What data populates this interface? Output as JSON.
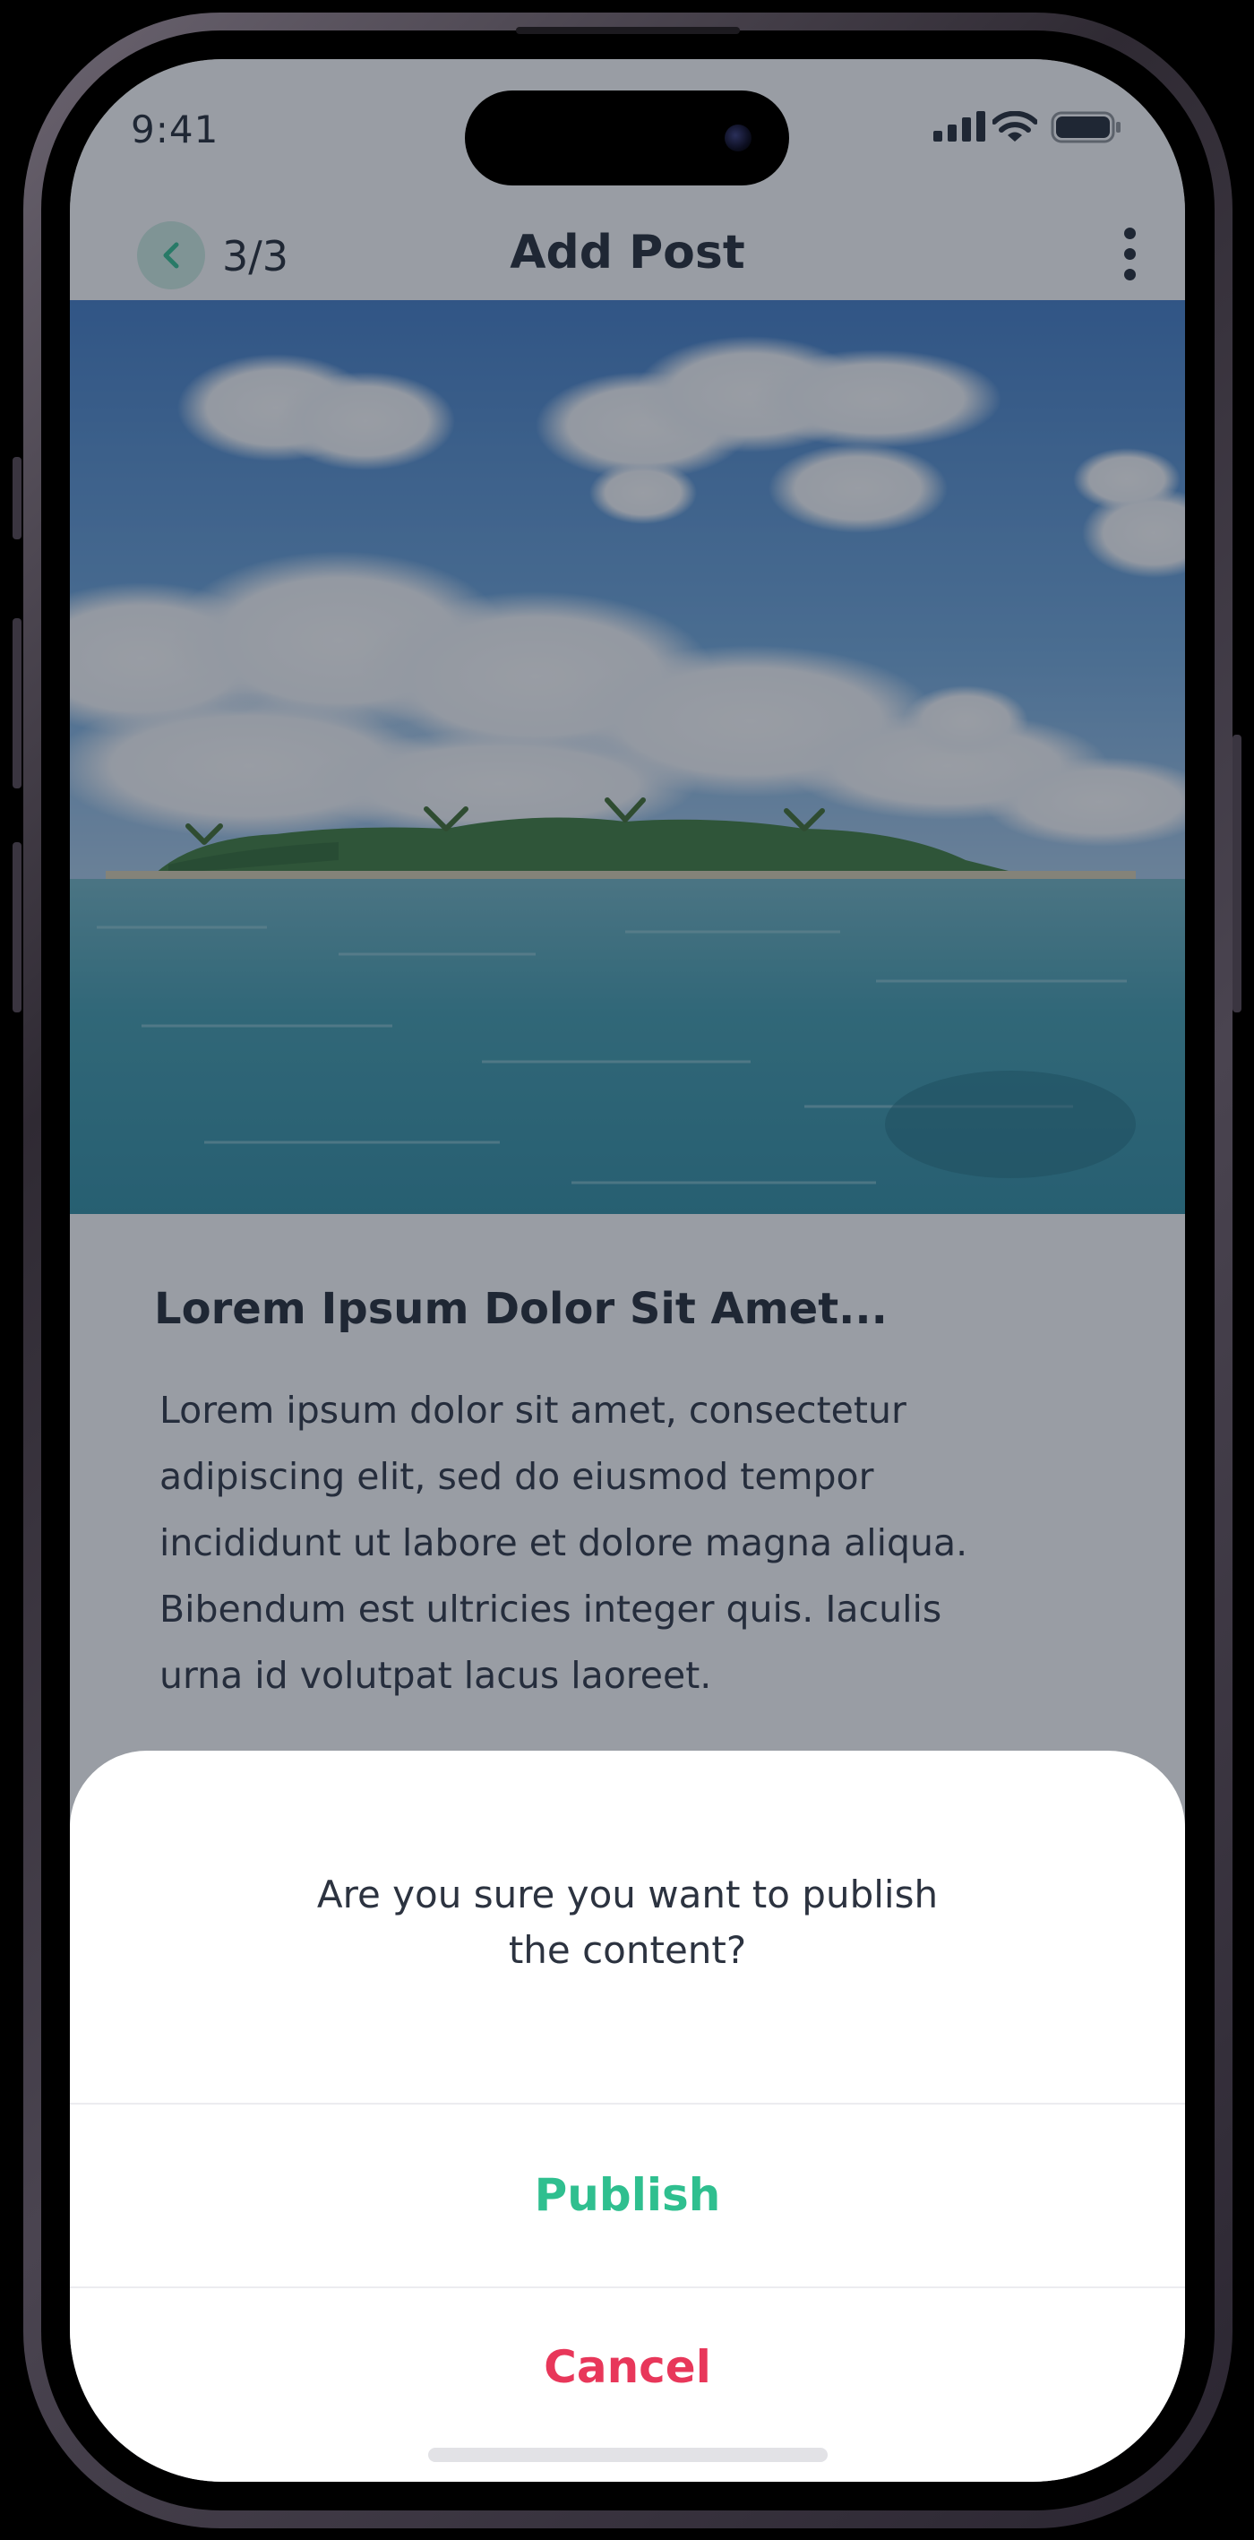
{
  "status_bar": {
    "time": "9:41",
    "icons": [
      "cellular-signal-icon",
      "wifi-icon",
      "battery-icon"
    ]
  },
  "header": {
    "back_icon": "chevron-left-icon",
    "step": "3/3",
    "title": "Add Post",
    "menu_icon": "more-vertical-icon"
  },
  "post": {
    "image_description": "tropical island photo",
    "title": "Lorem Ipsum Dolor Sit Amet...",
    "body_lines": [
      "Lorem ipsum dolor sit amet, consectetur",
      "adipiscing elit, sed do eiusmod tempor",
      "incididunt ut labore et dolore magna aliqua.",
      "Bibendum est ultricies integer quis. Iaculis",
      "urna id volutpat lacus laoreet."
    ]
  },
  "dialog": {
    "message_lines": [
      "Are you sure you want to publish",
      "the content?"
    ],
    "publish_label": "Publish",
    "cancel_label": "Cancel"
  },
  "colors": {
    "accent_green": "#2fbf8f",
    "danger_red": "#e8375a",
    "text_dark": "#1f2530",
    "overlay": "rgba(33,42,56,0.46)"
  }
}
